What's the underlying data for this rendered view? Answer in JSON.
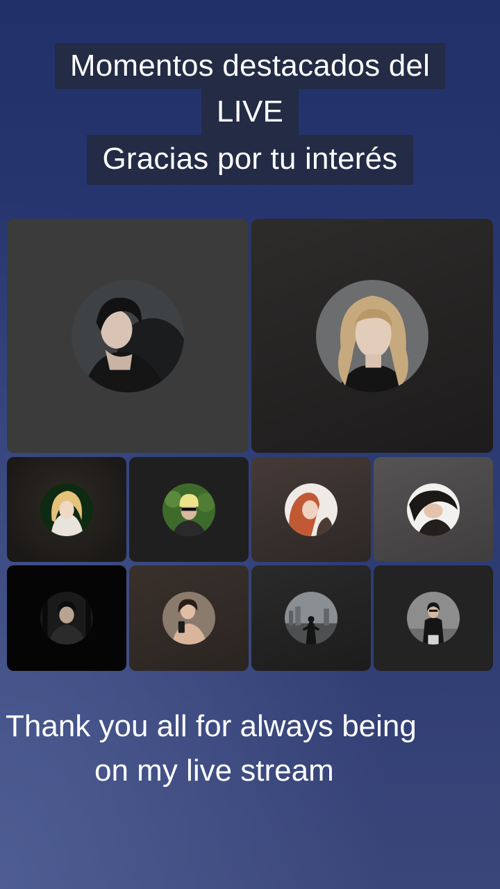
{
  "header": {
    "line1": "Momentos destacados del",
    "line2": "LIVE",
    "line3": "Gracias por tu interés"
  },
  "participants": [
    {
      "id": "p1",
      "icon": "user-avatar-man-dark-hair",
      "tile_color": "#3b3b3b"
    },
    {
      "id": "p2",
      "icon": "user-avatar-man-blonde-hair",
      "tile_color": "#252222"
    },
    {
      "id": "p3",
      "icon": "user-avatar-blonde",
      "tile_color": "#201d1b"
    },
    {
      "id": "p4",
      "icon": "user-avatar-beanie",
      "tile_color": "#222"
    },
    {
      "id": "p5",
      "icon": "user-avatar-redhead",
      "tile_color": "#3a302e"
    },
    {
      "id": "p6",
      "icon": "user-avatar-dark-hair-woman",
      "tile_color": "#4d4b4b"
    },
    {
      "id": "p7",
      "icon": "user-avatar-dim",
      "tile_color": "#0a0a0a"
    },
    {
      "id": "p8",
      "icon": "user-avatar-selfie",
      "tile_color": "#2f2926"
    },
    {
      "id": "p9",
      "icon": "user-avatar-silhouette",
      "tile_color": "#232323"
    },
    {
      "id": "p10",
      "icon": "user-avatar-street",
      "tile_color": "#222"
    }
  ],
  "footer": {
    "line1": "Thank you all for always being",
    "line2": "on my live stream"
  }
}
